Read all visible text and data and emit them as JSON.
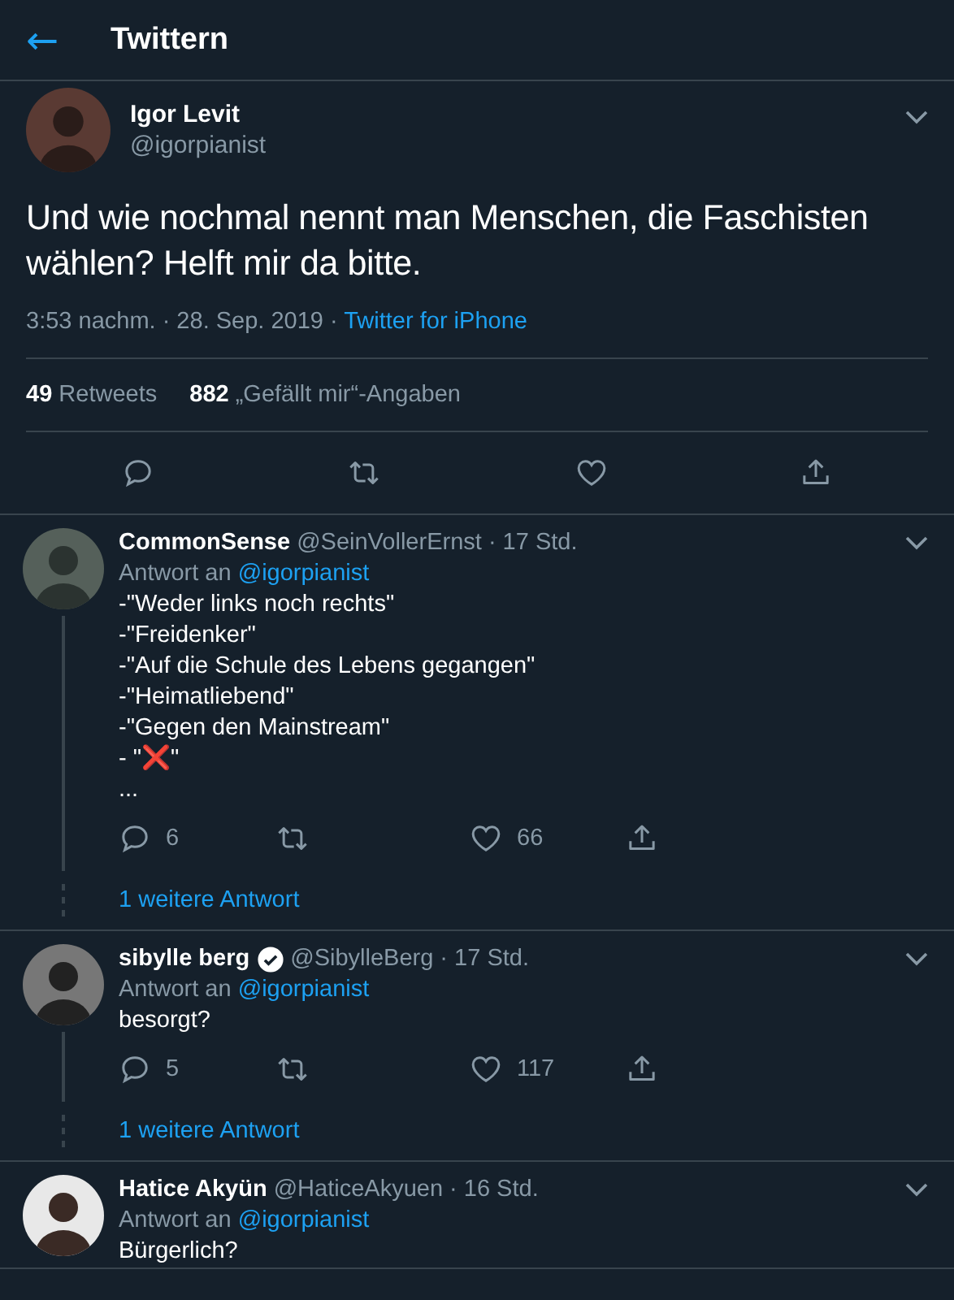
{
  "header": {
    "back": "←",
    "title": "Twittern"
  },
  "tweet": {
    "name": "Igor Levit",
    "handle": "@igorpianist",
    "text": "Und wie nochmal nennt man Menschen, die Faschisten wählen? Helft mir da bitte.",
    "time": "3:53 nachm. · 28. Sep. 2019 ·",
    "source": "Twitter for iPhone",
    "retweets_count": "49",
    "retweets_label": "Retweets",
    "likes_count": "882",
    "likes_label": "„Gefällt mir“-Angaben"
  },
  "replies": [
    {
      "name": "CommonSense",
      "verified": false,
      "handle": "@SeinVollerErnst · 17 Std.",
      "reply_to_label": "Antwort an",
      "reply_to": "@igorpianist",
      "text": "-\"Weder links noch rechts\"\n-\"Freidenker\"\n-\"Auf die Schule des Lebens gegangen\"\n-\"Heimatliebend\"\n-\"Gegen den Mainstream\"\n- \"❌\"\n...",
      "reply_count": "6",
      "like_count": "66",
      "more": "1 weitere Antwort"
    },
    {
      "name": "sibylle berg",
      "verified": true,
      "handle": "@SibylleBerg · 17 Std.",
      "reply_to_label": "Antwort an",
      "reply_to": "@igorpianist",
      "text": "besorgt?",
      "reply_count": "5",
      "like_count": "117",
      "more": "1 weitere Antwort"
    },
    {
      "name": "Hatice Akyün",
      "verified": false,
      "handle": "@HaticeAkyuen · 16 Std.",
      "reply_to_label": "Antwort an",
      "reply_to": "@igorpianist",
      "text": "Bürgerlich?"
    }
  ]
}
